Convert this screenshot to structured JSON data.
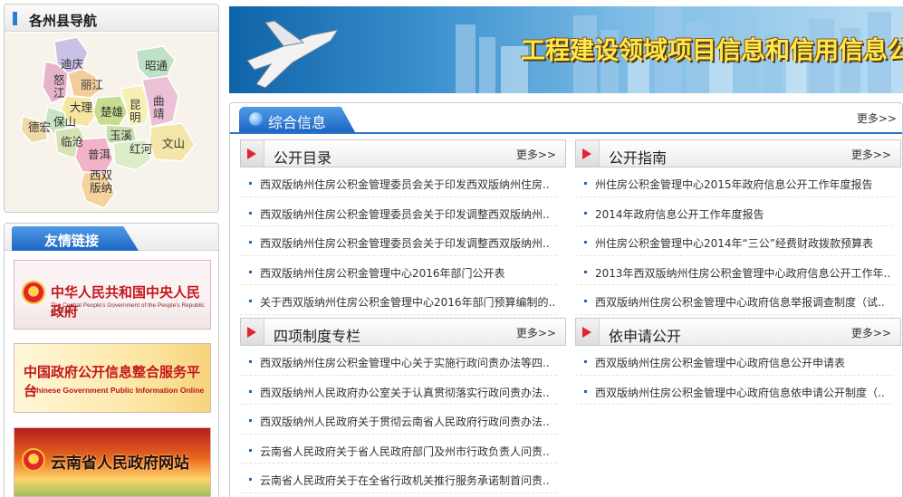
{
  "sidebar": {
    "county_nav": {
      "title": "各州县导航",
      "regions": [
        "迪庆",
        "怒江",
        "丽江",
        "昭通",
        "大理",
        "楚雄",
        "昆明",
        "曲靖",
        "保山",
        "德宏",
        "临沧",
        "玉溪",
        "普洱",
        "红河",
        "文山",
        "西双版纳"
      ]
    },
    "friend_links": {
      "title": "友情链接",
      "banners": [
        {
          "title": "中华人民共和国中央人民政府",
          "subtitle": "The Central People's Government of the People's Republic of China"
        },
        {
          "title": "中国政府公开信息整合服务平台",
          "subtitle": "Chinese Government Public Information Online"
        },
        {
          "title": "云南省人民政府网站",
          "subtitle": ""
        }
      ]
    }
  },
  "header": {
    "title": "工程建设领域项目信息和信用信息公开共享专栏"
  },
  "main": {
    "tab_label": "综合信息",
    "more_label": "更多>>",
    "panels": [
      {
        "title": "公开目录",
        "more": "更多>>",
        "items": [
          "西双版纳州住房公积金管理委员会关于印发西双版纳州住房..",
          "西双版纳州住房公积金管理委员会关于印发调整西双版纳州..",
          "西双版纳州住房公积金管理委员会关于印发调整西双版纳州..",
          "西双版纳州住房公积金管理中心2016年部门公开表",
          "关于西双版纳州住房公积金管理中心2016年部门预算编制的.."
        ]
      },
      {
        "title": "公开指南",
        "more": "更多>>",
        "items": [
          "州住房公积金管理中心2015年政府信息公开工作年度报告",
          "2014年政府信息公开工作年度报告",
          "州住房公积金管理中心2014年“三公”经费财政拨款预算表",
          "2013年西双版纳州住房公积金管理中心政府信息公开工作年..",
          "西双版纳州住房公积金管理中心政府信息举报调查制度（试.."
        ]
      },
      {
        "title": "四项制度专栏",
        "more": "更多>>",
        "items": [
          "西双版纳州住房公积金管理中心关于实施行政问责办法等四..",
          "西双版纳州人民政府办公室关于认真贯彻落实行政问责办法..",
          "西双版纳州人民政府关于贯彻云南省人民政府行政问责办法..",
          "云南省人民政府关于省人民政府部门及州市行政负责人问责..",
          "云南省人民政府关于在全省行政机关推行服务承诺制首问责.."
        ]
      },
      {
        "title": "依申请公开",
        "more": "更多>>",
        "items": [
          "西双版纳州住房公积金管理中心政府信息公开申请表",
          "西双版纳州住房公积金管理中心政府信息依申请公开制度（.."
        ]
      }
    ]
  }
}
